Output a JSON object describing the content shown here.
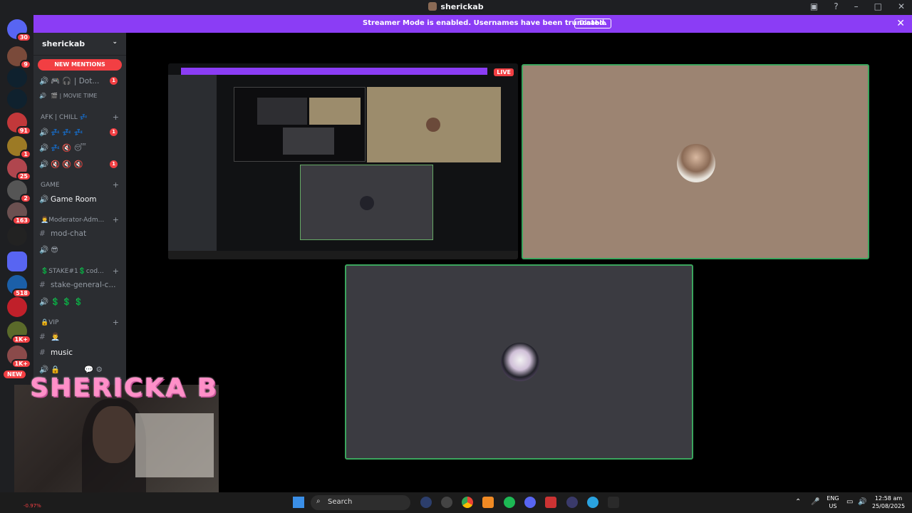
{
  "window": {
    "title": "sherickab"
  },
  "banner": {
    "message": "Streamer Mode is enabled. Usernames have been truncated.",
    "disable_label": "Disable"
  },
  "servers": [
    {
      "badge": "30"
    },
    {
      "badge": "9"
    },
    {
      "badge": ""
    },
    {
      "badge": ""
    },
    {
      "badge": "91"
    },
    {
      "badge": "1"
    },
    {
      "badge": "25"
    },
    {
      "badge": "2"
    },
    {
      "badge": "163"
    },
    {
      "badge": ""
    },
    {
      "badge": ""
    },
    {
      "badge": "518"
    },
    {
      "badge": ""
    },
    {
      "badge": "1K+"
    },
    {
      "badge": "1K+"
    }
  ],
  "sidebar": {
    "guild_name": "sherickab",
    "new_mentions": "NEW MENTIONS",
    "channels": [
      {
        "label": "🎮 🎧 | Dot...",
        "badge": "1"
      },
      {
        "label": "🎬 | MOVIE TIME",
        "badge": ""
      },
      {
        "category": "AFK | CHILL 💤"
      },
      {
        "label": "💤 💤 💤",
        "badge": "1"
      },
      {
        "label": "💤 🔇 😴",
        "badge": ""
      },
      {
        "label": "🔇 🔇 🔇",
        "badge": "1"
      },
      {
        "category": "GAME"
      },
      {
        "label": "Game Room",
        "badge": ""
      },
      {
        "category": "👨‍💼Moderator-Adm..."
      },
      {
        "label": "mod-chat",
        "badge": ""
      },
      {
        "label": "😎",
        "badge": ""
      },
      {
        "category": "💲STAKE#1💲cod..."
      },
      {
        "label": "stake-general-c...",
        "badge": ""
      },
      {
        "label": "💲 💲 💲",
        "badge": ""
      },
      {
        "category": "🔒VIP"
      },
      {
        "label": "👨‍💼",
        "badge": ""
      },
      {
        "label": "music",
        "badge": ""
      }
    ]
  },
  "stream": {
    "live_label": "LIVE"
  },
  "overlay": {
    "streamer_name": "SHERICKA B",
    "new_label": "NEW"
  },
  "taskbar": {
    "search_label": "Search",
    "lang": "ENG",
    "region": "US",
    "time": "12:58 am",
    "date": "25/08/2025",
    "ticker": "-0.97%"
  }
}
